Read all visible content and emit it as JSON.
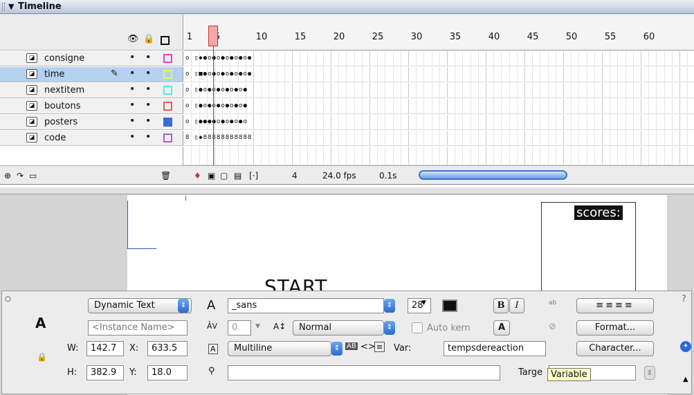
{
  "panel": {
    "title": "Timeline"
  },
  "ruler": {
    "labels": [
      "1",
      "5",
      "10",
      "15",
      "20",
      "25",
      "30",
      "35",
      "40",
      "45",
      "50",
      "55",
      "60"
    ]
  },
  "layers": [
    {
      "name": "consigne",
      "color": "#e83fd0",
      "selected": false
    },
    {
      "name": "time",
      "color": "#f0f05a",
      "selected": true
    },
    {
      "name": "nextitem",
      "color": "#5ae6f0",
      "selected": false
    },
    {
      "name": "boutons",
      "color": "#e85a5a",
      "selected": false
    },
    {
      "name": "posters",
      "color": "#3a6ad8",
      "selected": false
    },
    {
      "name": "code",
      "color": "#b05ad8",
      "selected": false
    }
  ],
  "timeline_bar": {
    "current_frame": "4",
    "fps": "24.0 fps",
    "time": "0.1s"
  },
  "stage": {
    "scores_label": "scores:",
    "start_label": "START"
  },
  "properties": {
    "text_type": "Dynamic Text",
    "instance_placeholder": "<Instance Name>",
    "font": "_sans",
    "font_size": "28",
    "tracking": "0",
    "char_position": "Normal",
    "auto_kern": "Auto kern",
    "format_button": "Format...",
    "character_button": "Character...",
    "line_type": "Multiline",
    "var_label": "Var:",
    "var_value": "tempsdereaction",
    "w_label": "W:",
    "w_value": "142.7",
    "h_label": "H:",
    "h_value": "382.9",
    "x_label": "X:",
    "x_value": "633.5",
    "y_label": "Y:",
    "y_value": "18.0",
    "target_label": "Targe",
    "tooltip": "Variable"
  }
}
